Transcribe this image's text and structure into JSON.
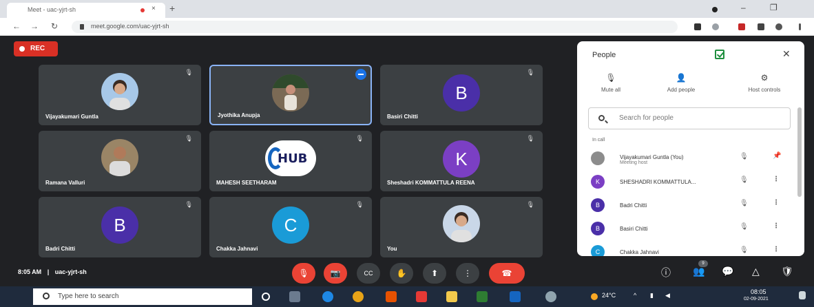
{
  "browser": {
    "tab_title": "Meet - uac-yjrt-sh",
    "close_tab": "×",
    "new_tab": "+",
    "url": "meet.google.com/uac-yjrt-sh",
    "nav": {
      "back": "←",
      "forward": "→",
      "reload": "↻"
    },
    "window": {
      "minimize": "–",
      "maximize": "❐"
    }
  },
  "recording": {
    "label": "REC"
  },
  "tiles": [
    {
      "name": "Vijayakumari Guntla",
      "kind": "photo",
      "photo_bg": "#a7c8e8"
    },
    {
      "name": "Jyothika Anupja",
      "kind": "photo",
      "photo_bg": "#7b6a55",
      "active": true
    },
    {
      "name": "Basiri Chitti",
      "kind": "letter",
      "letter": "B",
      "color": "#4a2fa8"
    },
    {
      "name": "Ramana Valluri",
      "kind": "photo",
      "photo_bg": "#9a8566"
    },
    {
      "name": "MAHESH SEETHARAM",
      "kind": "hub",
      "logo_text": "HUB"
    },
    {
      "name": "Sheshadri KOMMATTULA REENA",
      "kind": "letter",
      "letter": "K",
      "color": "#7b3fc4"
    },
    {
      "name": "Badri Chitti",
      "kind": "letter",
      "letter": "B",
      "color": "#4a2fa8"
    },
    {
      "name": "Chakka Jahnavi",
      "kind": "letter",
      "letter": "C",
      "color": "#1a9bd7"
    },
    {
      "name": "You",
      "kind": "photo",
      "photo_bg": "#c9d7e8"
    }
  ],
  "meeting": {
    "time": "8:05 AM",
    "separator": "|",
    "code": "uac-yjrt-sh"
  },
  "people_panel": {
    "title": "People",
    "close": "✕",
    "actions": [
      {
        "label": "Mute all",
        "icon": "🎙"
      },
      {
        "label": "Add people",
        "icon": "👤"
      },
      {
        "label": "Host controls",
        "icon": "⚙"
      }
    ],
    "search_placeholder": "Search for people",
    "section_label": "In call",
    "participants": [
      {
        "name": "Vijayakumari Guntla (You)",
        "sub": "Meeting host",
        "avatar": "",
        "color": "#8c8c8c",
        "photo": true,
        "mic": "🎙",
        "extra": "📌"
      },
      {
        "name": "SHESHADRI KOMMATTULA...",
        "sub": "",
        "avatar": "K",
        "color": "#7b3fc4",
        "mic": "🎙",
        "extra": "⋮"
      },
      {
        "name": "Badri Chitti",
        "sub": "",
        "avatar": "B",
        "color": "#4a2fa8",
        "mic": "🎙",
        "extra": "⋮"
      },
      {
        "name": "Basiri Chitti",
        "sub": "",
        "avatar": "B",
        "color": "#4a2fa8",
        "mic": "🎙",
        "extra": "⋮"
      },
      {
        "name": "Chakka Jahnavi",
        "sub": "",
        "avatar": "C",
        "color": "#1a9bd7",
        "mic": "🎙",
        "extra": "⋮"
      }
    ]
  },
  "controls": {
    "mic": "🎙",
    "camera": "📷",
    "captions": "CC",
    "hand": "✋",
    "present": "⬆",
    "more": "⋮",
    "hangup": "☎",
    "info": "ⓘ",
    "people": "👥",
    "people_count": "9",
    "chat": "💬",
    "activities": "△",
    "security": "🛡"
  },
  "taskbar": {
    "search_placeholder": "Type here to search",
    "weather": "24°C",
    "time": "08:05",
    "date": "02-09-2021"
  }
}
